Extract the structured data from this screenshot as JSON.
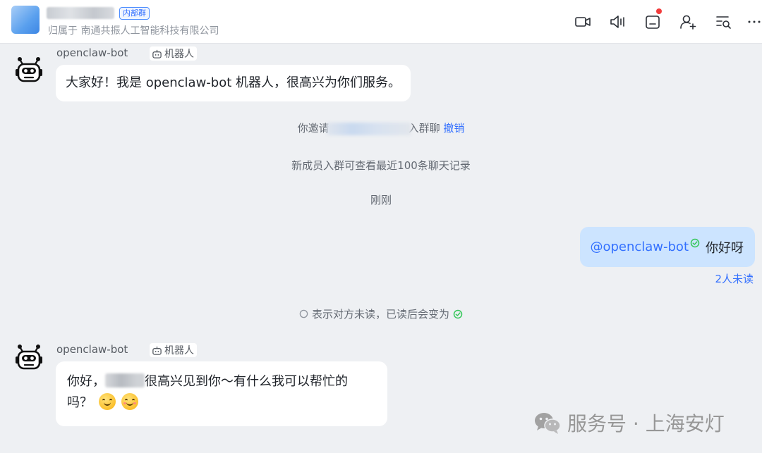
{
  "header": {
    "group_tag": "内部群",
    "org_line": "归属于 南通共振人工智能科技有限公司",
    "icons": [
      "video-call-icon",
      "mute-icon",
      "notice-icon",
      "add-member-icon",
      "search-history-icon",
      "more-icon"
    ]
  },
  "messages": [
    {
      "sender": "openclaw-bot",
      "sender_tag": "机器人",
      "text": "大家好！我是 openclaw-bot 机器人，很高兴为你们服务。"
    },
    {
      "sender": "openclaw-bot",
      "sender_tag": "机器人",
      "text_before": "你好，",
      "text_after": "很高兴见到你～有什么我可以帮忙的",
      "text_line2": "吗？"
    }
  ],
  "system": {
    "invite_prefix": "你邀请",
    "invite_suffix": "入群聊",
    "undo": "撤销",
    "history_notice": "新成员入群可查看最近100条聊天记录",
    "time": "刚刚",
    "read_hint": "表示对方未读，已读后会变为"
  },
  "outgoing": {
    "mention": "@openclaw-bot",
    "text": "你好呀",
    "read_status": "2人未读"
  },
  "watermark": {
    "text": "服务号 · 上海安灯"
  },
  "colors": {
    "accent": "#3370ff",
    "outgoing_bubble": "#cce4ff",
    "read_check": "#34c759",
    "notification_dot": "#f23c3c"
  }
}
